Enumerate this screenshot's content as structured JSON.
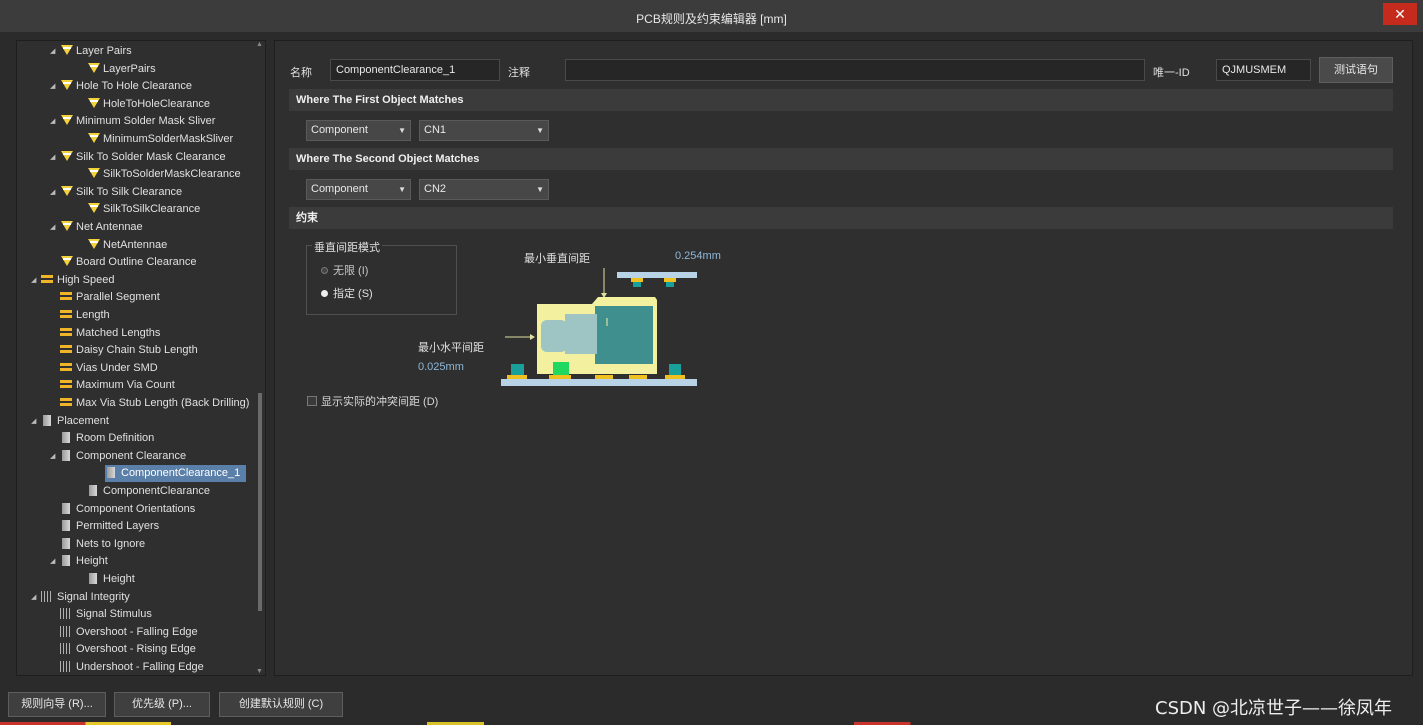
{
  "window": {
    "title": "PCB规则及约束编辑器 [mm]",
    "close_glyph": "✕"
  },
  "tree": {
    "items": [
      {
        "label": "Layer Pairs",
        "icon": "rule-icon",
        "level": 2,
        "expander": "◢"
      },
      {
        "label": "LayerPairs",
        "icon": "rule-icon",
        "level": 3,
        "expander": ""
      },
      {
        "label": "Hole To Hole Clearance",
        "icon": "rule-icon",
        "level": 2,
        "expander": "◢"
      },
      {
        "label": "HoleToHoleClearance",
        "icon": "rule-icon",
        "level": 3,
        "expander": ""
      },
      {
        "label": "Minimum Solder Mask Sliver",
        "icon": "rule-icon",
        "level": 2,
        "expander": "◢"
      },
      {
        "label": "MinimumSolderMaskSliver",
        "icon": "rule-icon",
        "level": 3,
        "expander": ""
      },
      {
        "label": "Silk To Solder Mask Clearance",
        "icon": "rule-icon",
        "level": 2,
        "expander": "◢"
      },
      {
        "label": "SilkToSolderMaskClearance",
        "icon": "rule-icon",
        "level": 3,
        "expander": ""
      },
      {
        "label": "Silk To Silk Clearance",
        "icon": "rule-icon",
        "level": 2,
        "expander": "◢"
      },
      {
        "label": "SilkToSilkClearance",
        "icon": "rule-icon",
        "level": 3,
        "expander": ""
      },
      {
        "label": "Net Antennae",
        "icon": "rule-icon",
        "level": 2,
        "expander": "◢"
      },
      {
        "label": "NetAntennae",
        "icon": "rule-icon",
        "level": 3,
        "expander": ""
      },
      {
        "label": "Board Outline Clearance",
        "icon": "rule-icon",
        "level": 2,
        "expander": ""
      },
      {
        "label": "High Speed",
        "icon": "high-speed-icon",
        "level": 1,
        "expander": "◢"
      },
      {
        "label": "Parallel Segment",
        "icon": "high-speed-icon",
        "level": 2,
        "expander": ""
      },
      {
        "label": "Length",
        "icon": "high-speed-icon",
        "level": 2,
        "expander": ""
      },
      {
        "label": "Matched Lengths",
        "icon": "high-speed-icon",
        "level": 2,
        "expander": ""
      },
      {
        "label": "Daisy Chain Stub Length",
        "icon": "high-speed-icon",
        "level": 2,
        "expander": ""
      },
      {
        "label": "Vias Under SMD",
        "icon": "high-speed-icon",
        "level": 2,
        "expander": ""
      },
      {
        "label": "Maximum Via Count",
        "icon": "high-speed-icon",
        "level": 2,
        "expander": ""
      },
      {
        "label": "Max Via Stub Length (Back Drilling)",
        "icon": "high-speed-icon",
        "level": 2,
        "expander": ""
      },
      {
        "label": "Placement",
        "icon": "placement-icon",
        "level": 1,
        "expander": "◢"
      },
      {
        "label": "Room Definition",
        "icon": "placement-icon",
        "level": 2,
        "expander": ""
      },
      {
        "label": "Component Clearance",
        "icon": "placement-icon",
        "level": 2,
        "expander": "◢"
      },
      {
        "label": "ComponentClearance_1",
        "icon": "placement-icon",
        "level": 3,
        "expander": "",
        "selected": true
      },
      {
        "label": "ComponentClearance",
        "icon": "placement-icon",
        "level": 3,
        "expander": ""
      },
      {
        "label": "Component Orientations",
        "icon": "placement-icon",
        "level": 2,
        "expander": ""
      },
      {
        "label": "Permitted Layers",
        "icon": "placement-icon",
        "level": 2,
        "expander": ""
      },
      {
        "label": "Nets to Ignore",
        "icon": "placement-icon",
        "level": 2,
        "expander": ""
      },
      {
        "label": "Height",
        "icon": "placement-icon",
        "level": 2,
        "expander": "◢"
      },
      {
        "label": "Height",
        "icon": "placement-icon",
        "level": 3,
        "expander": ""
      },
      {
        "label": "Signal Integrity",
        "icon": "signal-integrity-icon",
        "level": 1,
        "expander": "◢"
      },
      {
        "label": "Signal Stimulus",
        "icon": "signal-integrity-icon",
        "level": 2,
        "expander": ""
      },
      {
        "label": "Overshoot - Falling Edge",
        "icon": "signal-integrity-icon",
        "level": 2,
        "expander": ""
      },
      {
        "label": "Overshoot - Rising Edge",
        "icon": "signal-integrity-icon",
        "level": 2,
        "expander": ""
      },
      {
        "label": "Undershoot - Falling Edge",
        "icon": "signal-integrity-icon",
        "level": 2,
        "expander": ""
      }
    ]
  },
  "rule": {
    "name_label": "名称",
    "name_value": "ComponentClearance_1",
    "comment_label": "注释",
    "comment_value": "",
    "uid_label": "唯一-ID",
    "uid_value": "QJMUSMEM",
    "test_button": "测试语句"
  },
  "first_match": {
    "header": "Where The First Object Matches",
    "type": "Component",
    "value": "CN1"
  },
  "second_match": {
    "header": "Where The Second Object Matches",
    "type": "Component",
    "value": "CN2"
  },
  "constraints": {
    "header": "约束",
    "mode_group_title": "垂直间距模式",
    "option_infinite": "无限 (I)",
    "option_specified": "指定 (S)",
    "selected_option": "specified",
    "min_vertical_label": "最小垂直间距",
    "min_vertical_value": "0.254mm",
    "min_horizontal_label": "最小水平间距",
    "min_horizontal_value": "0.025mm",
    "show_actual_label": "显示实际的冲突间距 (D)",
    "show_actual_checked": false
  },
  "bottom": {
    "wizard_button": "规则向导 (R)...",
    "priority_button": "优先级 (P)...",
    "create_default_button": "创建默认规则 (C)",
    "watermark": "CSDN @北凉世子——徐凤年"
  }
}
